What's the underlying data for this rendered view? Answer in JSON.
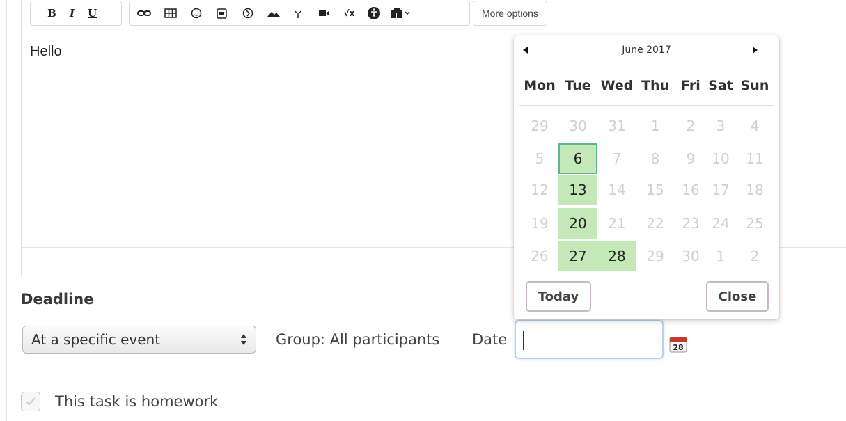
{
  "editor": {
    "toolbar": {
      "bold": "B",
      "italic": "I",
      "underline": "U",
      "more_options": "More options"
    },
    "content": "Hello"
  },
  "deadline": {
    "heading": "Deadline",
    "select_value": "At a specific event",
    "group_label": "Group: All participants",
    "date_label": "Date",
    "date_value": ""
  },
  "homework": {
    "label": "This task is homework",
    "checked": true
  },
  "datepicker": {
    "title": "June 2017",
    "weekdays": [
      "Mon",
      "Tue",
      "Wed",
      "Thu",
      "Fri",
      "Sat",
      "Sun"
    ],
    "weeks": [
      [
        "29",
        "30",
        "31",
        "1",
        "2",
        "3",
        "4"
      ],
      [
        "5",
        "6",
        "7",
        "8",
        "9",
        "10",
        "11"
      ],
      [
        "12",
        "13",
        "14",
        "15",
        "16",
        "17",
        "18"
      ],
      [
        "19",
        "20",
        "21",
        "22",
        "23",
        "24",
        "25"
      ],
      [
        "26",
        "27",
        "28",
        "29",
        "30",
        "1",
        "2"
      ]
    ],
    "available": [
      "6",
      "13",
      "20",
      "27",
      "28"
    ],
    "selected": "6",
    "today_label": "Today",
    "close_label": "Close",
    "icon_day": "28"
  }
}
